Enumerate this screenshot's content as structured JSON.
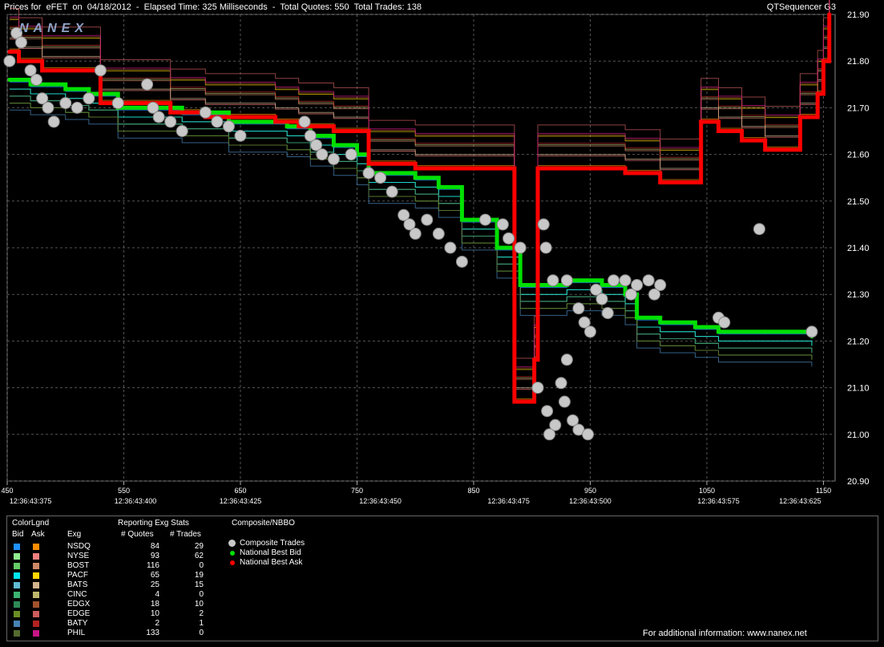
{
  "header": {
    "title": "Prices for  eFET  on  04/18/2012  -  Elapsed Time: 325 Milliseconds  -  Total Quotes: 550  Total Trades: 138",
    "app_name": "QTSequencer G3",
    "logo_text": "NANEX"
  },
  "chart_data": {
    "type": "line",
    "title": "Prices for  eFET  on  04/18/2012",
    "xlim": [
      450,
      1160
    ],
    "ylim": [
      20.9,
      21.9
    ],
    "x_ticks": [
      450,
      550,
      650,
      750,
      850,
      950,
      1050,
      1150
    ],
    "y_ticks": [
      "20.90",
      "21.00",
      "21.10",
      "21.20",
      "21.30",
      "21.40",
      "21.50",
      "21.60",
      "21.70",
      "21.80",
      "21.90"
    ],
    "time_labels": [
      {
        "x": 470,
        "label": "12:36:43:375"
      },
      {
        "x": 560,
        "label": "12:36:43:400"
      },
      {
        "x": 650,
        "label": "12:36:43:425"
      },
      {
        "x": 770,
        "label": "12:36:43:450"
      },
      {
        "x": 880,
        "label": "12:36:43:475"
      },
      {
        "x": 950,
        "label": "12:36:43:500"
      },
      {
        "x": 1060,
        "label": "12:36:43:575"
      },
      {
        "x": 1130,
        "label": "12:36:43:625"
      }
    ],
    "grid": true,
    "series": [
      {
        "name": "National Best Bid",
        "color": "#00e000",
        "points": [
          [
            452,
            21.76
          ],
          [
            470,
            21.75
          ],
          [
            500,
            21.74
          ],
          [
            520,
            21.73
          ],
          [
            540,
            21.73
          ],
          [
            545,
            21.7
          ],
          [
            600,
            21.69
          ],
          [
            640,
            21.67
          ],
          [
            670,
            21.67
          ],
          [
            690,
            21.66
          ],
          [
            710,
            21.64
          ],
          [
            730,
            21.62
          ],
          [
            750,
            21.6
          ],
          [
            760,
            21.56
          ],
          [
            800,
            21.55
          ],
          [
            820,
            21.53
          ],
          [
            840,
            21.46
          ],
          [
            870,
            21.4
          ],
          [
            890,
            21.32
          ],
          [
            930,
            21.33
          ],
          [
            960,
            21.32
          ],
          [
            980,
            21.3
          ],
          [
            990,
            21.25
          ],
          [
            1010,
            21.24
          ],
          [
            1040,
            21.23
          ],
          [
            1060,
            21.22
          ],
          [
            1100,
            21.22
          ],
          [
            1140,
            21.21
          ]
        ]
      },
      {
        "name": "National Best Ask",
        "color": "#ff0000",
        "points": [
          [
            452,
            21.82
          ],
          [
            460,
            21.8
          ],
          [
            480,
            21.78
          ],
          [
            530,
            21.71
          ],
          [
            570,
            21.71
          ],
          [
            590,
            21.69
          ],
          [
            620,
            21.68
          ],
          [
            660,
            21.68
          ],
          [
            680,
            21.67
          ],
          [
            700,
            21.66
          ],
          [
            730,
            21.65
          ],
          [
            760,
            21.58
          ],
          [
            800,
            21.57
          ],
          [
            880,
            21.57
          ],
          [
            885,
            21.07
          ],
          [
            898,
            21.07
          ],
          [
            902,
            21.16
          ],
          [
            905,
            21.57
          ],
          [
            940,
            21.57
          ],
          [
            980,
            21.56
          ],
          [
            1000,
            21.56
          ],
          [
            1010,
            21.54
          ],
          [
            1030,
            21.54
          ],
          [
            1045,
            21.67
          ],
          [
            1060,
            21.65
          ],
          [
            1080,
            21.63
          ],
          [
            1100,
            21.61
          ],
          [
            1130,
            21.68
          ],
          [
            1145,
            21.73
          ],
          [
            1150,
            21.8
          ],
          [
            1155,
            21.9
          ]
        ]
      }
    ],
    "trades": [
      [
        452,
        21.8
      ],
      [
        458,
        21.86
      ],
      [
        462,
        21.84
      ],
      [
        470,
        21.78
      ],
      [
        475,
        21.76
      ],
      [
        480,
        21.72
      ],
      [
        485,
        21.7
      ],
      [
        490,
        21.67
      ],
      [
        500,
        21.71
      ],
      [
        510,
        21.7
      ],
      [
        520,
        21.72
      ],
      [
        530,
        21.78
      ],
      [
        545,
        21.71
      ],
      [
        570,
        21.75
      ],
      [
        575,
        21.7
      ],
      [
        580,
        21.68
      ],
      [
        590,
        21.67
      ],
      [
        600,
        21.65
      ],
      [
        620,
        21.69
      ],
      [
        630,
        21.67
      ],
      [
        640,
        21.66
      ],
      [
        650,
        21.64
      ],
      [
        705,
        21.67
      ],
      [
        710,
        21.64
      ],
      [
        715,
        21.62
      ],
      [
        720,
        21.6
      ],
      [
        730,
        21.59
      ],
      [
        745,
        21.6
      ],
      [
        760,
        21.56
      ],
      [
        770,
        21.55
      ],
      [
        780,
        21.52
      ],
      [
        790,
        21.47
      ],
      [
        795,
        21.45
      ],
      [
        800,
        21.43
      ],
      [
        810,
        21.46
      ],
      [
        820,
        21.43
      ],
      [
        830,
        21.4
      ],
      [
        840,
        21.37
      ],
      [
        860,
        21.46
      ],
      [
        875,
        21.45
      ],
      [
        880,
        21.42
      ],
      [
        890,
        21.4
      ],
      [
        910,
        21.45
      ],
      [
        912,
        21.4
      ],
      [
        918,
        21.33
      ],
      [
        930,
        21.33
      ],
      [
        940,
        21.27
      ],
      [
        945,
        21.24
      ],
      [
        950,
        21.22
      ],
      [
        955,
        21.31
      ],
      [
        960,
        21.29
      ],
      [
        965,
        21.26
      ],
      [
        970,
        21.33
      ],
      [
        980,
        21.33
      ],
      [
        985,
        21.3
      ],
      [
        990,
        21.32
      ],
      [
        1000,
        21.33
      ],
      [
        1005,
        21.3
      ],
      [
        1010,
        21.32
      ],
      [
        1060,
        21.25
      ],
      [
        1065,
        21.24
      ],
      [
        1095,
        21.44
      ],
      [
        1140,
        21.22
      ],
      [
        930,
        21.16
      ],
      [
        925,
        21.11
      ],
      [
        928,
        21.07
      ],
      [
        935,
        21.03
      ],
      [
        940,
        21.01
      ],
      [
        948,
        21.0
      ],
      [
        920,
        21.02
      ],
      [
        915,
        21.0
      ],
      [
        913,
        21.05
      ],
      [
        905,
        21.1
      ]
    ]
  },
  "legend": {
    "title": "ColorLgnd",
    "col_bid": "Bid",
    "col_ask": "Ask",
    "col_exg": "Exg",
    "stats_title": "Reporting Exg Stats",
    "col_quotes": "# Quotes",
    "col_trades": "# Trades",
    "rows": [
      {
        "exg": "NSDQ",
        "quotes": "84",
        "trades": "29",
        "bid": "#1e90ff",
        "ask": "#ff8c00"
      },
      {
        "exg": "NYSE",
        "quotes": "93",
        "trades": "62",
        "bid": "#90ee90",
        "ask": "#f08080"
      },
      {
        "exg": "BOST",
        "quotes": "116",
        "trades": "0",
        "bid": "#66cc66",
        "ask": "#cc8866"
      },
      {
        "exg": "PACF",
        "quotes": "65",
        "trades": "19",
        "bid": "#00e5ee",
        "ask": "#ffd700"
      },
      {
        "exg": "BATS",
        "quotes": "25",
        "trades": "15",
        "bid": "#5fbcd3",
        "ask": "#d2b48c"
      },
      {
        "exg": "CINC",
        "quotes": "4",
        "trades": "0",
        "bid": "#3cb371",
        "ask": "#bdb76b"
      },
      {
        "exg": "EDGX",
        "quotes": "18",
        "trades": "10",
        "bid": "#2e8b57",
        "ask": "#a0522d"
      },
      {
        "exg": "EDGE",
        "quotes": "10",
        "trades": "2",
        "bid": "#6b8e23",
        "ask": "#cd5c5c"
      },
      {
        "exg": "BATY",
        "quotes": "2",
        "trades": "1",
        "bid": "#4682b4",
        "ask": "#b22222"
      },
      {
        "exg": "PHIL",
        "quotes": "133",
        "trades": "0",
        "bid": "#556b2f",
        "ask": "#c71585"
      }
    ],
    "composite_title": "Composite/NBBO",
    "composite_items": [
      {
        "label": "Composite Trades",
        "color": "#c8c8c8"
      },
      {
        "label": "National Best Bid",
        "color": "#00e000"
      },
      {
        "label": "National Best Ask",
        "color": "#ff0000"
      }
    ],
    "footer": "For additional information: www.nanex.net"
  }
}
